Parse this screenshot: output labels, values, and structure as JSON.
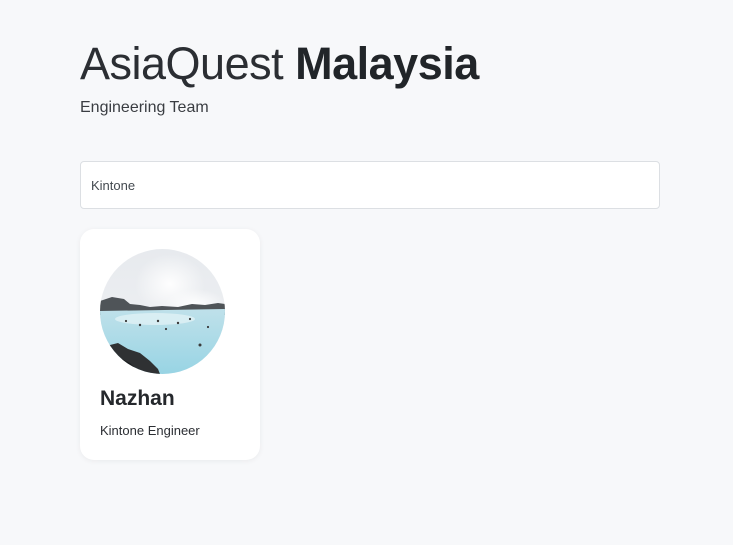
{
  "header": {
    "brand_light": "AsiaQuest",
    "brand_bold": "Malaysia",
    "subtitle": "Engineering Team"
  },
  "search": {
    "value": "Kintone"
  },
  "members": [
    {
      "name": "Nazhan",
      "role": "Kintone Engineer",
      "photo": "hot-spring-lagoon-photo"
    }
  ]
}
